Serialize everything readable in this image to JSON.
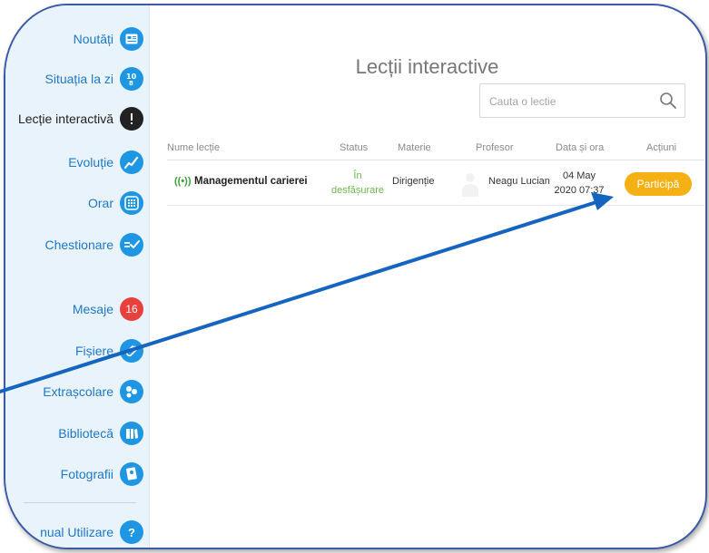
{
  "sidebar": {
    "items": [
      {
        "label": "Noutăți",
        "icon": "newspaper-icon"
      },
      {
        "label": "Situația la zi",
        "icon": "numbers-icon"
      },
      {
        "label": "Lecție interactivă",
        "icon": "exclamation-icon"
      },
      {
        "label": "Evoluție",
        "icon": "trend-icon"
      },
      {
        "label": "Orar",
        "icon": "calendar-icon"
      },
      {
        "label": "Chestionare",
        "icon": "checklist-icon"
      },
      {
        "label": "Mesaje",
        "badge": "16"
      },
      {
        "label": "Fișiere",
        "icon": "paperclip-icon"
      },
      {
        "label": "Extrașcolare",
        "icon": "activities-icon"
      },
      {
        "label": "Bibliotecă",
        "icon": "book-icon"
      },
      {
        "label": "Fotografii",
        "icon": "photo-icon"
      },
      {
        "label": "nual Utilizare",
        "icon_text": "?"
      }
    ]
  },
  "main": {
    "title": "Lecții interactive",
    "search": {
      "placeholder": "Cauta o lectie"
    },
    "table": {
      "headers": [
        "Nume lecție",
        "Status",
        "Materie",
        "Profesor",
        "Data și ora",
        "Acțiuni"
      ],
      "rows": [
        {
          "live_icon": "((•))",
          "name": "Managementul carierei",
          "status_line1": "În",
          "status_line2": "desfășurare",
          "subject": "Dirigenție",
          "teacher": "Neagu Lucian",
          "date": "04 May",
          "time": "2020 07:37",
          "action": "Participă"
        }
      ]
    }
  },
  "colors": {
    "accent": "#1f96e4",
    "sidebar_bg": "#e9f3fb",
    "button": "#f5b014",
    "status": "#6ab84a",
    "annotation_arrow": "#1565c0"
  }
}
